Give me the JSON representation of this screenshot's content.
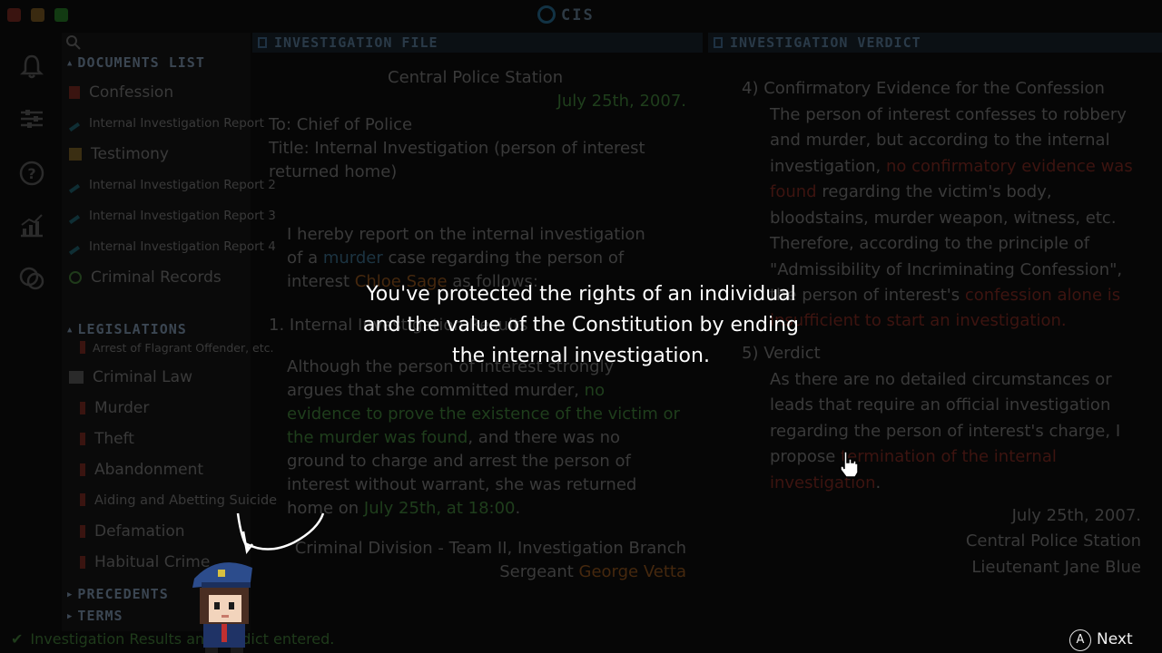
{
  "app": {
    "title": "CIS",
    "accent_color": "#2e3a44"
  },
  "window_buttons": [
    {
      "name": "close",
      "color": "#3a1410"
    },
    {
      "name": "minimize",
      "color": "#3a2a10"
    },
    {
      "name": "maximize",
      "color": "#123a12"
    }
  ],
  "sidebar_icons": [
    "bell-icon",
    "sliders-icon",
    "help-icon",
    "chart-icon",
    "discuss-icon"
  ],
  "documents": {
    "header": "DOCUMENTS LIST",
    "items": [
      {
        "label": "Confession",
        "icon": "confession-icon"
      },
      {
        "label": "Internal Investigation Report",
        "icon": "report-icon"
      },
      {
        "label": "Testimony",
        "icon": "testimony-icon"
      },
      {
        "label": "Internal Investigation Report 2",
        "icon": "report-icon"
      },
      {
        "label": "Internal Investigation Report 3",
        "icon": "report-icon"
      },
      {
        "label": "Internal Investigation Report 4",
        "icon": "report-icon"
      },
      {
        "label": "Criminal Records",
        "icon": "records-icon"
      }
    ]
  },
  "legislations": {
    "header": "LEGISLATIONS",
    "arrest_item": "Arrest of Flagrant Offender, etc.",
    "criminal_law": "Criminal Law",
    "laws": [
      "Murder",
      "Theft",
      "Abandonment",
      "Aiding and Abetting Suicide",
      "Defamation",
      "Habitual Crime"
    ]
  },
  "precedents": {
    "header": "PRECEDENTS"
  },
  "terms": {
    "header": "TERMS"
  },
  "investigation_file": {
    "header": "INVESTIGATION FILE",
    "station": "Central Police Station",
    "date": "July 25th, 2007.",
    "to": "To: Chief of Police",
    "title_line1": "Title: Internal Investigation (person of interest",
    "title_line2": "returned home)",
    "p1_line1": "I hereby report on the internal investigation",
    "p1_line2a": "of a ",
    "p1_line2_link": "murder",
    "p1_line2b": " case regarding the person of",
    "p1_line3a": "interest ",
    "p1_line3_name": "Chloe Sage",
    "p1_line3b": " as follows:",
    "item1": "1. Internal Investigation Results",
    "p2_line1": "Although the person of interest strongly",
    "p2_line2a": "argues that she committed murder, ",
    "p2_line2_green": "no",
    "p2_line3_green": "evidence to prove the existence of the victim or",
    "p2_line4_green": "the murder was found",
    "p2_line4b": ", and there was no",
    "p2_line5": "ground to charge and arrest the person of",
    "p2_line6": "interest without warrant, she was returned",
    "p2_line7a": "home on ",
    "p2_line7_green": "July 25th, at 18:00",
    "p2_line7b": ".",
    "division": "Criminal Division - Team II, Investigation Branch",
    "rank": "Sergeant ",
    "officer": "George Vetta"
  },
  "investigation_verdict": {
    "header": "INVESTIGATION VERDICT",
    "s4_title": "4) Confirmatory Evidence for the Confession",
    "s4_l1": "The person of interest confesses to robbery",
    "s4_l2": "and murder, but according to the internal",
    "s4_l3a": "investigation, ",
    "s4_l3_red": "no confirmatory evidence was",
    "s4_l4_red": "found",
    "s4_l4b": " regarding the victim's body,",
    "s4_l5": "bloodstains, murder weapon, witness, etc.",
    "s4_l6": "Therefore, according to the principle of",
    "s4_l7": "\"Admissibility of Incriminating Confession\",",
    "s4_l8a": "the person of interest's ",
    "s4_l8_red": "confession alone is",
    "s4_l9_red": "insufficient to start an investigation.",
    "s5_title": "5) Verdict",
    "s5_l1": "As there are no detailed circumstances or",
    "s5_l2": "leads that require an official investigation",
    "s5_l3": "regarding the person of interest's charge, I",
    "s5_l4a": "propose ",
    "s5_l4_red": "termination of the internal",
    "s5_l5_red": "investigation",
    "s5_l5b": ".",
    "sig_date": "July 25th, 2007.",
    "sig_station": "Central Police Station",
    "sig_officer": "Lieutenant Jane Blue"
  },
  "status_bar": {
    "text": "Investigation Results and Verdict entered."
  },
  "overlay": {
    "line1": "You've protected the rights of an individual",
    "line2": "and the value of the Constitution by ending",
    "line3": "the internal investigation."
  },
  "next_button": {
    "glyph": "A",
    "label": "Next"
  }
}
